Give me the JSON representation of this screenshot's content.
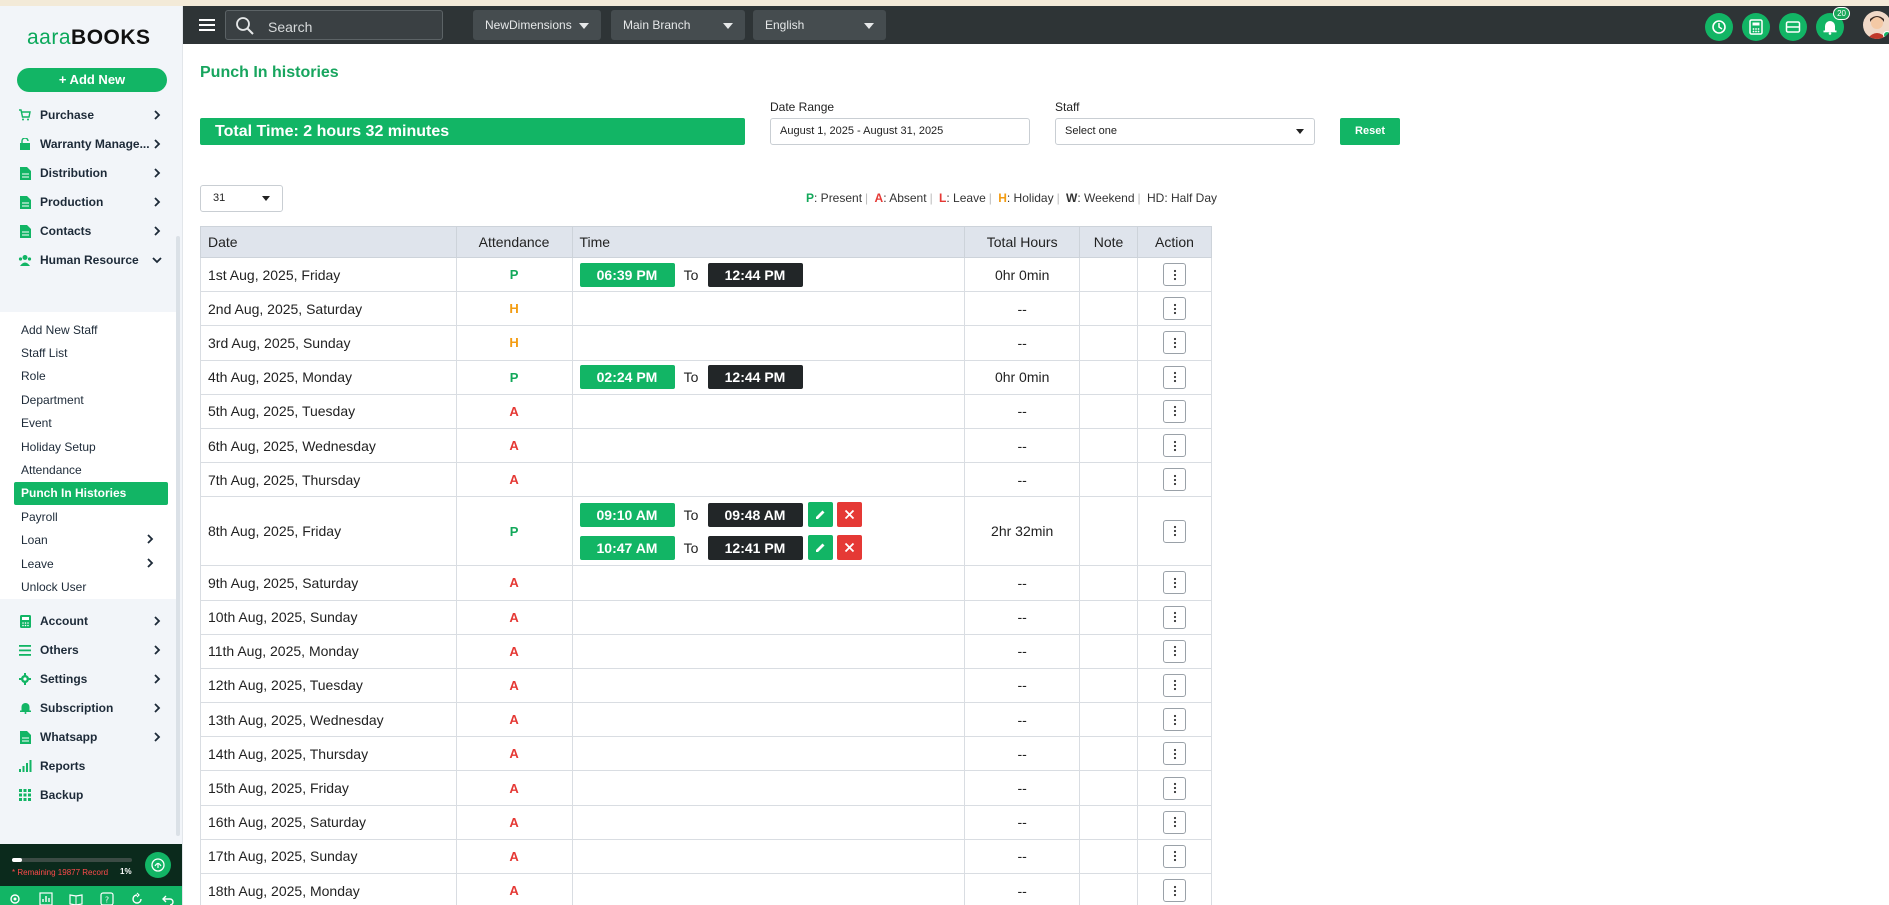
{
  "app": {
    "logo_part1": "aara",
    "logo_part2": "BOOKS",
    "add_new": "+ Add New"
  },
  "sidebar": {
    "top_items": [
      {
        "label": "Purchase",
        "icon": "cart-icon"
      },
      {
        "label": "Warranty Manage...",
        "icon": "lock-icon"
      },
      {
        "label": "Distribution",
        "icon": "document-icon"
      },
      {
        "label": "Production",
        "icon": "document-icon"
      },
      {
        "label": "Contacts",
        "icon": "document-icon"
      },
      {
        "label": "Human Resource",
        "icon": "users-icon"
      }
    ],
    "hr_items": [
      "Add New Staff",
      "Staff List",
      "Role",
      "Department",
      "Event",
      "Holiday Setup",
      "Attendance",
      "Punch In Histories",
      "Payroll",
      "Loan",
      "Leave",
      "Unlock User"
    ],
    "bottom_items": [
      {
        "label": "Account",
        "icon": "calculator-icon"
      },
      {
        "label": "Others",
        "icon": "list-icon"
      },
      {
        "label": "Settings",
        "icon": "gear-icon"
      },
      {
        "label": "Subscription",
        "icon": "bell-icon"
      },
      {
        "label": "Whatsapp",
        "icon": "document-icon"
      },
      {
        "label": "Reports",
        "icon": "bar-chart-icon"
      },
      {
        "label": "Backup",
        "icon": "grid-icon"
      }
    ],
    "record_text": "* Remaining 19877 Record",
    "record_pct": "1%",
    "record_fraction": 0.01
  },
  "header": {
    "search_placeholder": "Search",
    "company": "NewDimensions",
    "branch": "Main Branch",
    "language": "English",
    "notif_count": "20"
  },
  "page": {
    "title": "Punch In histories",
    "total_time": "Total Time: 2 hours 32 minutes",
    "date_range_label": "Date Range",
    "date_range_value": "August 1, 2025 - August 31, 2025",
    "staff_label": "Staff",
    "staff_value": "Select one",
    "reset": "Reset",
    "per_page": "31",
    "legend": {
      "p_key": "P",
      "p_text": ": Present",
      "a_key": "A",
      "a_text": ": Absent",
      "l_key": "L",
      "l_text": ": Leave",
      "h_key": "H",
      "h_text": ": Holiday",
      "w_key": "W",
      "w_text": ": Weekend",
      "hd_text": "HD: Half Day"
    }
  },
  "table": {
    "headers": {
      "date": "Date",
      "attendance": "Attendance",
      "time": "Time",
      "total_hours": "Total Hours",
      "note": "Note",
      "action": "Action"
    },
    "to_label": "To",
    "rows": [
      {
        "date": "1st Aug, 2025, Friday",
        "att": "P",
        "slots": [
          {
            "in": "06:39 PM",
            "out": "12:44 PM",
            "edit": false
          }
        ],
        "hours": "0hr 0min"
      },
      {
        "date": "2nd Aug, 2025, Saturday",
        "att": "H",
        "slots": [],
        "hours": "--"
      },
      {
        "date": "3rd Aug, 2025, Sunday",
        "att": "H",
        "slots": [],
        "hours": "--"
      },
      {
        "date": "4th Aug, 2025, Monday",
        "att": "P",
        "slots": [
          {
            "in": "02:24 PM",
            "out": "12:44 PM",
            "edit": false
          }
        ],
        "hours": "0hr 0min"
      },
      {
        "date": "5th Aug, 2025, Tuesday",
        "att": "A",
        "slots": [],
        "hours": "--"
      },
      {
        "date": "6th Aug, 2025, Wednesday",
        "att": "A",
        "slots": [],
        "hours": "--"
      },
      {
        "date": "7th Aug, 2025, Thursday",
        "att": "A",
        "slots": [],
        "hours": "--"
      },
      {
        "date": "8th Aug, 2025, Friday",
        "att": "P",
        "slots": [
          {
            "in": "09:10 AM",
            "out": "09:48 AM",
            "edit": true
          },
          {
            "in": "10:47 AM",
            "out": "12:41 PM",
            "edit": true
          }
        ],
        "hours": "2hr 32min"
      },
      {
        "date": "9th Aug, 2025, Saturday",
        "att": "A",
        "slots": [],
        "hours": "--"
      },
      {
        "date": "10th Aug, 2025, Sunday",
        "att": "A",
        "slots": [],
        "hours": "--"
      },
      {
        "date": "11th Aug, 2025, Monday",
        "att": "A",
        "slots": [],
        "hours": "--"
      },
      {
        "date": "12th Aug, 2025, Tuesday",
        "att": "A",
        "slots": [],
        "hours": "--"
      },
      {
        "date": "13th Aug, 2025, Wednesday",
        "att": "A",
        "slots": [],
        "hours": "--"
      },
      {
        "date": "14th Aug, 2025, Thursday",
        "att": "A",
        "slots": [],
        "hours": "--"
      },
      {
        "date": "15th Aug, 2025, Friday",
        "att": "A",
        "slots": [],
        "hours": "--"
      },
      {
        "date": "16th Aug, 2025, Saturday",
        "att": "A",
        "slots": [],
        "hours": "--"
      },
      {
        "date": "17th Aug, 2025, Sunday",
        "att": "A",
        "slots": [],
        "hours": "--"
      },
      {
        "date": "18th Aug, 2025, Monday",
        "att": "A",
        "slots": [],
        "hours": "--"
      }
    ]
  },
  "colors": {
    "accent": "#12b565",
    "dark": "#2e3436",
    "absent": "#e53935",
    "holiday": "#f39c12"
  }
}
